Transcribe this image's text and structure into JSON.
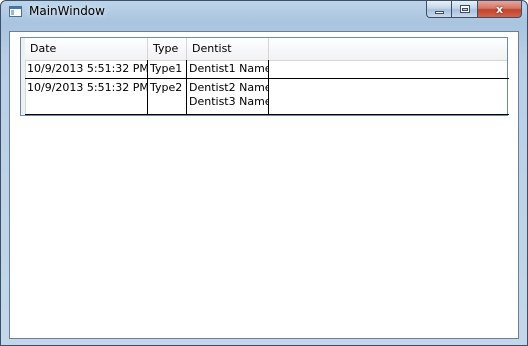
{
  "window": {
    "title": "MainWindow",
    "close_glyph": "x",
    "icons": [
      "app-window-icon",
      "minimize-icon",
      "maximize-icon",
      "close-icon"
    ]
  },
  "grid": {
    "columns": [
      "Date",
      "Type",
      "Dentist"
    ],
    "rows": [
      {
        "date": "10/9/2013 5:51:32 PM",
        "type": "Type1",
        "dentists": [
          "Dentist1 Name"
        ]
      },
      {
        "date": "10/9/2013 5:51:32 PM",
        "type": "Type2",
        "dentists": [
          "Dentist2 Name",
          "Dentist3 Name"
        ]
      }
    ]
  }
}
